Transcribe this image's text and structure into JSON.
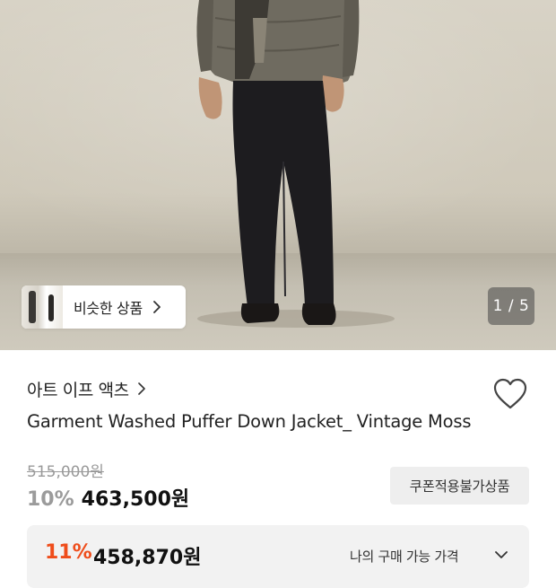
{
  "gallery": {
    "similar_products_label": "비슷한 상품",
    "image_counter": "1 / 5"
  },
  "product": {
    "brand": "아트 이프 액츠",
    "title": "Garment Washed Puffer Down Jacket_ Vintage Moss",
    "original_price": "515,000원",
    "discount_rate": "10%",
    "sale_price": "463,500원",
    "coupon_badge": "쿠폰적용불가상품"
  },
  "best_price": {
    "discount_rate": "11%",
    "price": "458,870원",
    "label": "나의 구매 가능 가격"
  },
  "colors": {
    "accent_orange": "#ef4d1b",
    "muted_gray": "#9b9b9b"
  },
  "icons": {
    "similar": "chevron-right-icon",
    "brand": "chevron-right-icon",
    "wishlist": "heart-outline-icon",
    "best_price": "chevron-down-icon"
  }
}
